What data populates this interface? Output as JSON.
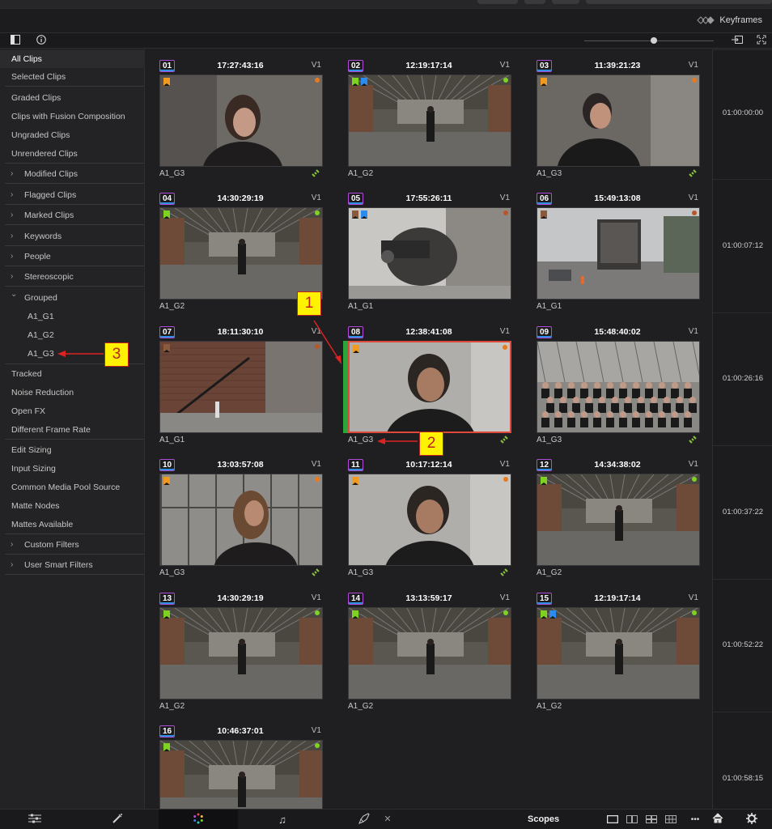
{
  "header": {
    "keyframes_label": "Keyframes"
  },
  "sidebar": {
    "items": [
      {
        "label": "All Clips",
        "active": true
      },
      {
        "label": "Selected Clips"
      },
      {
        "label": "Graded Clips"
      },
      {
        "label": "Clips with Fusion Composition"
      },
      {
        "label": "Ungraded Clips"
      },
      {
        "label": "Unrendered Clips"
      },
      {
        "label": "Modified Clips",
        "expandable": true
      },
      {
        "label": "Flagged Clips",
        "expandable": true
      },
      {
        "label": "Marked Clips",
        "expandable": true
      },
      {
        "label": "Keywords",
        "expandable": true
      },
      {
        "label": "People",
        "expandable": true
      },
      {
        "label": "Stereoscopic",
        "expandable": true
      },
      {
        "label": "Grouped",
        "expandable": true,
        "expanded": true
      },
      {
        "label": "A1_G1",
        "sub": true
      },
      {
        "label": "A1_G2",
        "sub": true
      },
      {
        "label": "A1_G3",
        "sub": true
      },
      {
        "label": "Tracked"
      },
      {
        "label": "Noise Reduction"
      },
      {
        "label": "Open FX"
      },
      {
        "label": "Different Frame Rate"
      },
      {
        "label": "Edit Sizing"
      },
      {
        "label": "Input Sizing"
      },
      {
        "label": "Common Media Pool Source"
      },
      {
        "label": "Matte Nodes"
      },
      {
        "label": "Mattes Available"
      },
      {
        "label": "Custom Filters",
        "expandable": true
      },
      {
        "label": "User Smart Filters",
        "expandable": true
      }
    ]
  },
  "clips": [
    {
      "num": "01",
      "tc": "17:27:43:16",
      "track": "V1",
      "name": "A1_G3",
      "linked": true,
      "flags": [
        "#f29a1f"
      ],
      "dot": "#e8791f",
      "scene": "interview-dark"
    },
    {
      "num": "02",
      "tc": "12:19:17:14",
      "track": "V1",
      "name": "A1_G2",
      "linked": false,
      "flags": [
        "#7ed321",
        "#2a8cf0"
      ],
      "dot": "#7ed321",
      "scene": "warehouse"
    },
    {
      "num": "03",
      "tc": "11:39:21:23",
      "track": "V1",
      "name": "A1_G3",
      "linked": true,
      "flags": [
        "#f29a1f"
      ],
      "dot": "#e8791f",
      "scene": "interview-leather"
    },
    {
      "num": "04",
      "tc": "14:30:29:19",
      "track": "V1",
      "name": "A1_G2",
      "linked": false,
      "flags": [
        "#7ed321"
      ],
      "dot": "#7ed321",
      "scene": "warehouse"
    },
    {
      "num": "05",
      "tc": "17:55:26:11",
      "track": "V1",
      "name": "A1_G1",
      "linked": false,
      "flags": [
        "#8b5a3c",
        "#2a8cf0"
      ],
      "dot": "#b8562a",
      "scene": "camera-crew"
    },
    {
      "num": "06",
      "tc": "15:49:13:08",
      "track": "V1",
      "name": "A1_G1",
      "linked": false,
      "flags": [
        "#8b5a3c"
      ],
      "dot": "#b8562a",
      "scene": "truck"
    },
    {
      "num": "07",
      "tc": "18:11:30:10",
      "track": "V1",
      "name": "A1_G1",
      "linked": false,
      "flags": [
        "#8b5a3c"
      ],
      "dot": "#b8562a",
      "scene": "brick-stairs"
    },
    {
      "num": "08",
      "tc": "12:38:41:08",
      "track": "V1",
      "name": "A1_G3",
      "linked": true,
      "flags": [
        "#f29a1f"
      ],
      "dot": "#e8791f",
      "scene": "interview-bright",
      "selected": true
    },
    {
      "num": "09",
      "tc": "15:48:40:02",
      "track": "V1",
      "name": "A1_G3",
      "linked": true,
      "flags": [],
      "dot": "",
      "scene": "group-photo"
    },
    {
      "num": "10",
      "tc": "13:03:57:08",
      "track": "V1",
      "name": "A1_G3",
      "linked": true,
      "flags": [
        "#f29a1f"
      ],
      "dot": "#e8791f",
      "scene": "interview-window"
    },
    {
      "num": "11",
      "tc": "10:17:12:14",
      "track": "V1",
      "name": "A1_G3",
      "linked": true,
      "flags": [
        "#f29a1f"
      ],
      "dot": "#e8791f",
      "scene": "interview-bright"
    },
    {
      "num": "12",
      "tc": "14:34:38:02",
      "track": "V1",
      "name": "A1_G2",
      "linked": false,
      "flags": [
        "#7ed321"
      ],
      "dot": "#7ed321",
      "scene": "warehouse"
    },
    {
      "num": "13",
      "tc": "14:30:29:19",
      "track": "V1",
      "name": "A1_G2",
      "linked": false,
      "flags": [
        "#7ed321"
      ],
      "dot": "#7ed321",
      "scene": "warehouse"
    },
    {
      "num": "14",
      "tc": "13:13:59:17",
      "track": "V1",
      "name": "A1_G2",
      "linked": false,
      "flags": [
        "#7ed321"
      ],
      "dot": "#7ed321",
      "scene": "warehouse"
    },
    {
      "num": "15",
      "tc": "12:19:17:14",
      "track": "V1",
      "name": "A1_G2",
      "linked": false,
      "flags": [
        "#7ed321",
        "#2a8cf0"
      ],
      "dot": "#7ed321",
      "scene": "warehouse"
    },
    {
      "num": "16",
      "tc": "10:46:37:01",
      "track": "V1",
      "name": "",
      "linked": false,
      "flags": [
        "#7ed321"
      ],
      "dot": "#7ed321",
      "scene": "warehouse"
    }
  ],
  "ruler": [
    "01:00:00:00",
    "01:00:07:12",
    "01:00:26:16",
    "01:00:37:22",
    "01:00:52:22",
    "01:00:58:15"
  ],
  "annotations": [
    "1",
    "2",
    "3"
  ],
  "bottom": {
    "scopes_label": "Scopes",
    "close_glyph": "✕",
    "more_glyph": "•••"
  },
  "colors": {
    "flag_orange": "#f29a1f",
    "flag_green": "#7ed321",
    "flag_blue": "#2a8cf0",
    "flag_brown": "#8b5a3c",
    "selection_red": "#e0483a",
    "annotation_yellow": "#fff200",
    "annotation_red": "#c01f1f"
  }
}
